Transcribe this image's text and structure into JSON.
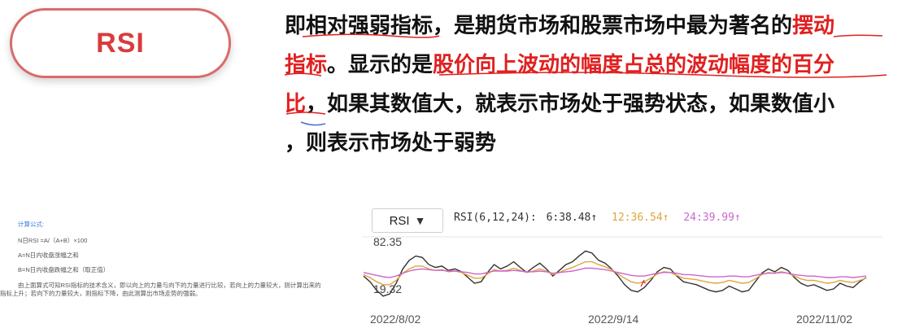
{
  "badge": {
    "label": "RSI"
  },
  "description": {
    "lines": [
      [
        {
          "t": "即相对强弱指标，是期货市场和股票市场中最为著名的",
          "red": false
        },
        {
          "t": "摆动",
          "red": true
        }
      ],
      [
        {
          "t": "指标",
          "red": true
        },
        {
          "t": "。显示的是",
          "red": false
        },
        {
          "t": "股价向上波动的幅度占总的波动幅度的百分",
          "red": true
        }
      ],
      [
        {
          "t": "比",
          "red": true
        },
        {
          "t": "，如果其数值大，就表示市场处于强势状态，如果数值小",
          "red": false
        }
      ],
      [
        {
          "t": "，则表示市场处于弱势",
          "red": false
        }
      ]
    ]
  },
  "formula": {
    "title": "计算公式:",
    "line1": "N日RSI =A/（A+B）×100",
    "line2": "A=N日内收盘涨幅之和",
    "line3": "B=N日内收盘跌幅之和（取正值）",
    "para": "由上面算式可知RSI指标的技术含义，即以向上的力量与向下的力量进行比较，若向上的力量较大，则计算出来的指标上升；若向下的力量较大，则指标下降，由此测算出市场走势的强弱。"
  },
  "chart_header": {
    "selector_label": "RSI",
    "params": "RSI(6,12,24):",
    "rsi6": "6:38.48↑",
    "rsi12": "12:36.54↑",
    "rsi24": "24:39.99↑"
  },
  "colors": {
    "rsi6": "#333333",
    "rsi12": "#e0a53a",
    "rsi24": "#cc66cc",
    "accent_red": "#e02020"
  },
  "chart_data": {
    "type": "line",
    "title": "",
    "y_tick_labels": [
      "82.35",
      "19.32"
    ],
    "x_tick_labels": [
      "2022/8/02",
      "2022/9/14",
      "2022/11/02"
    ],
    "ylim": [
      19.32,
      82.35
    ],
    "series": [
      {
        "name": "RSI6",
        "color": "#333333",
        "values": [
          50,
          42,
          30,
          22,
          25,
          40,
          60,
          72,
          78,
          76,
          66,
          62,
          64,
          58,
          60,
          56,
          48,
          40,
          42,
          55,
          66,
          60,
          64,
          70,
          62,
          55,
          62,
          68,
          60,
          50,
          58,
          66,
          70,
          78,
          85,
          82,
          72,
          68,
          60,
          50,
          38,
          30,
          28,
          34,
          44,
          56,
          62,
          60,
          50,
          42,
          40,
          38,
          34,
          30,
          28,
          30,
          36,
          32,
          28,
          30,
          42,
          54,
          60,
          56,
          62,
          58,
          48,
          40,
          36,
          38,
          34,
          30,
          32,
          40,
          36,
          34,
          42,
          48
        ]
      },
      {
        "name": "RSI12",
        "color": "#e0a53a",
        "values": [
          52,
          48,
          42,
          38,
          38,
          44,
          54,
          60,
          64,
          64,
          60,
          58,
          59,
          56,
          57,
          55,
          51,
          47,
          47,
          53,
          59,
          57,
          58,
          61,
          58,
          55,
          57,
          60,
          57,
          52,
          55,
          59,
          62,
          66,
          70,
          70,
          66,
          63,
          59,
          53,
          47,
          42,
          40,
          42,
          47,
          53,
          56,
          55,
          51,
          47,
          46,
          45,
          43,
          41,
          40,
          41,
          44,
          42,
          40,
          41,
          46,
          52,
          55,
          54,
          56,
          54,
          50,
          46,
          44,
          44,
          42,
          40,
          41,
          44,
          42,
          41,
          44,
          47
        ]
      },
      {
        "name": "RSI24",
        "color": "#cc66cc",
        "values": [
          55,
          53,
          51,
          49,
          48,
          50,
          54,
          57,
          59,
          60,
          59,
          58,
          58,
          57,
          57,
          56,
          55,
          53,
          53,
          55,
          57,
          57,
          57,
          58,
          57,
          56,
          56,
          57,
          56,
          54,
          55,
          56,
          57,
          59,
          61,
          61,
          60,
          59,
          57,
          55,
          53,
          51,
          50,
          50,
          52,
          54,
          55,
          55,
          54,
          52,
          52,
          51,
          50,
          49,
          49,
          49,
          50,
          50,
          49,
          49,
          51,
          53,
          54,
          54,
          55,
          54,
          52,
          51,
          50,
          50,
          49,
          48,
          48,
          49,
          49,
          48,
          49,
          50
        ]
      }
    ]
  }
}
